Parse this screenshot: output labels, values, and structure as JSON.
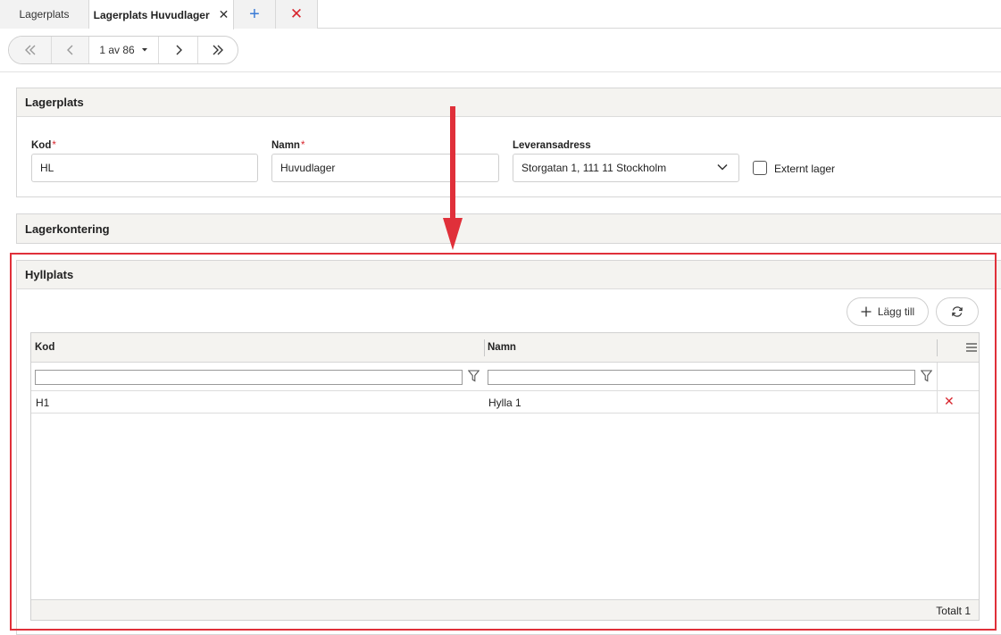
{
  "tabs": [
    {
      "label": "Lagerplats"
    },
    {
      "label": "Lagerplats Huvudlager"
    }
  ],
  "tab_icons": {
    "close": "close-icon",
    "add": "plus-icon",
    "close_all": "close-all-icon"
  },
  "pager": {
    "position": "1 av 86"
  },
  "lagerplats_panel": {
    "title": "Lagerplats",
    "kod": {
      "label": "Kod",
      "required_mark": "*",
      "value": "HL"
    },
    "namn": {
      "label": "Namn",
      "required_mark": "*",
      "value": "Huvudlager"
    },
    "leveransadress": {
      "label": "Leveransadress",
      "value": "Storgatan 1, 111 11 Stockholm"
    },
    "externt_lager": {
      "label": "Externt lager",
      "checked": false
    }
  },
  "lagerkontering_panel": {
    "title": "Lagerkontering"
  },
  "hyllplats_panel": {
    "title": "Hyllplats",
    "add_button": "Lägg till",
    "columns": [
      "Kod",
      "Namn"
    ],
    "rows": [
      {
        "kod": "H1",
        "namn": "Hylla 1"
      }
    ],
    "footer": "Totalt 1"
  },
  "colors": {
    "accent_red": "#e0303a",
    "required_red": "#d8262e",
    "add_blue": "#3a7bd5"
  }
}
